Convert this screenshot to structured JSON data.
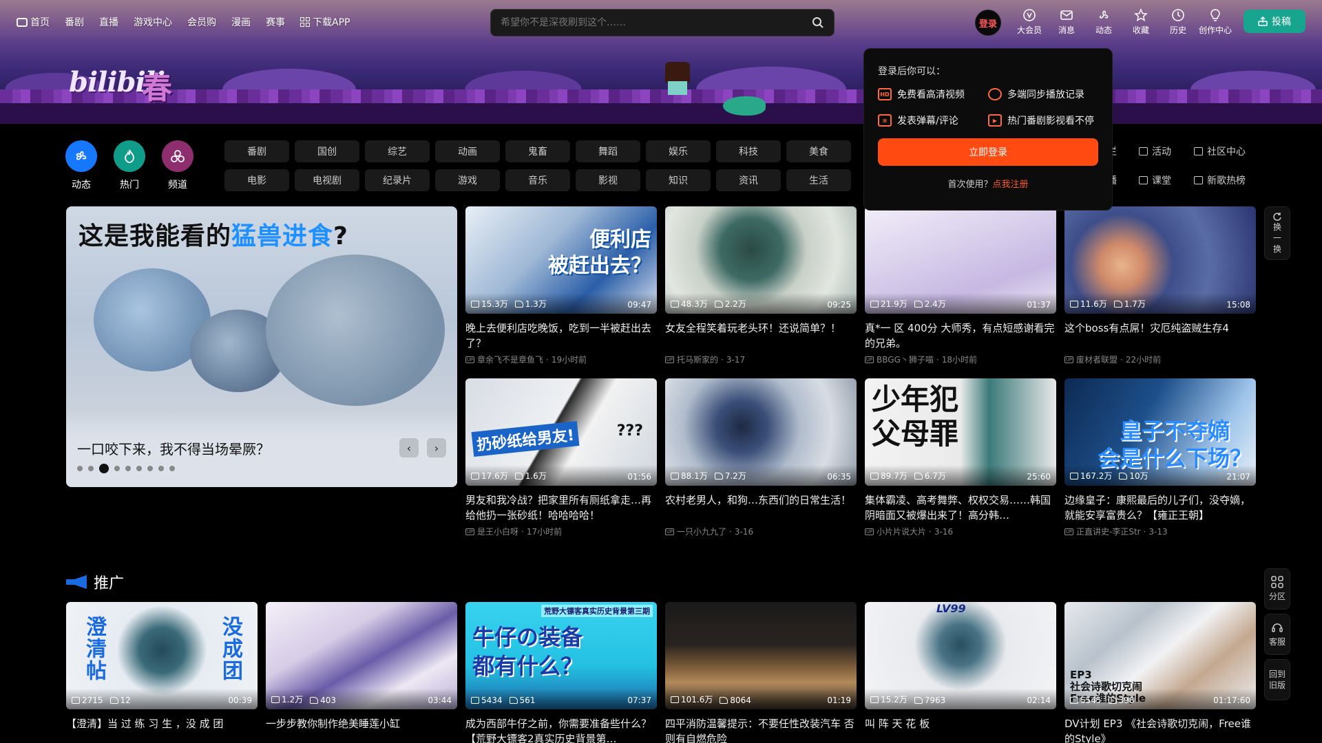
{
  "topnav": {
    "items": [
      "首页",
      "番剧",
      "直播",
      "游戏中心",
      "会员购",
      "漫画",
      "赛事",
      "下载APP"
    ]
  },
  "search": {
    "placeholder": "希望你不是深夜刷到这个……"
  },
  "header": {
    "login_avatar": "登录",
    "right": [
      "大会员",
      "消息",
      "动态",
      "收藏",
      "历史",
      "创作中心"
    ],
    "upload": "投稿"
  },
  "popover": {
    "head": "登录后你可以：",
    "perks": [
      "免费看高清视频",
      "多端同步播放记录",
      "发表弹幕/评论",
      "热门番剧影视看不停"
    ],
    "login_button": "立即登录",
    "register_prefix": "首次使用？",
    "register_link": "点我注册"
  },
  "quick": [
    "动态",
    "热门",
    "频道"
  ],
  "tags": [
    "番剧",
    "国创",
    "综艺",
    "动画",
    "鬼畜",
    "舞蹈",
    "娱乐",
    "科技",
    "美食",
    "电影",
    "电视剧",
    "纪录片",
    "游戏",
    "音乐",
    "影视",
    "知识",
    "资讯",
    "生活"
  ],
  "sidelinks": [
    "专栏",
    "活动",
    "社区中心",
    "直播",
    "课堂",
    "新歌热榜"
  ],
  "carousel": {
    "headline_pre": "这是我能看的",
    "headline_blue": "猛兽进食",
    "headline_post": "?",
    "title": "一口咬下来，我不得当场晕厥？",
    "dots": 9,
    "active_dot": 2
  },
  "feed": [
    {
      "views": "15.3万",
      "likes": "1.3万",
      "duration": "09:47",
      "title": "晚上去便利店吃晚饭，吃到一半被赶出去了？",
      "author": "章余飞不是章鱼飞",
      "time": "19小时前",
      "overlay": "便利店\n被赶出去？"
    },
    {
      "views": "48.3万",
      "likes": "2.2万",
      "duration": "09:25",
      "title": "女友全程笑着玩老头环！还说简单？！",
      "author": "托马斯家的",
      "time": "3-17",
      "overlay": ""
    },
    {
      "views": "21.9万",
      "likes": "2.4万",
      "duration": "01:37",
      "title": "真*一 区 400分 大师秀，有点短感谢看完的兄弟。",
      "author": "BBGG丶狮子喵",
      "time": "18小时前",
      "overlay": ""
    },
    {
      "views": "11.6万",
      "likes": "1.7万",
      "duration": "15:08",
      "title": "这个boss有点屌！灾厄纯盗贼生存4",
      "author": "废材者联盟",
      "time": "22小时前",
      "overlay": ""
    },
    {
      "views": "17.6万",
      "likes": "1.6万",
      "duration": "01:56",
      "title": "男友和我冷战？把家里所有厕纸拿走…再给他扔一张砂纸！哈哈哈哈！",
      "author": "是王小白呀",
      "time": "17小时前",
      "overlay": "扔砂纸给男友!"
    },
    {
      "views": "88.1万",
      "likes": "7.2万",
      "duration": "06:35",
      "title": "农村老男人，和狗…东西们的日常生活！",
      "author": "一只小九九了",
      "time": "3-16",
      "overlay": ""
    },
    {
      "views": "89.7万",
      "likes": "6.7万",
      "duration": "25:60",
      "title": "集体霸凌、高考舞弊、权权交易……韩国阴暗面又被爆出来了！高分韩…",
      "author": "小片片说大片",
      "time": "3-16",
      "overlay": "少年犯\n父母罪"
    },
    {
      "views": "167.2万",
      "likes": "10万",
      "duration": "21:07",
      "title": "边缘皇子：康熙最后的儿子们，没夺嫡，就能安享富贵么？【雍正王朝】",
      "author": "正直讲史-李正Str",
      "time": "3-13",
      "overlay": "皇子不夺嫡\n会是什么下场？"
    }
  ],
  "promo_title": "推广",
  "promo": [
    {
      "views": "2715",
      "likes": "12",
      "duration": "00:39",
      "title": "【澄清】当 过 练 习 生 ，没 成 团",
      "overlay_l": "澄清帖",
      "overlay_r": "没成团"
    },
    {
      "views": "1.2万",
      "likes": "403",
      "duration": "03:44",
      "title": "一步步教你制作绝美睡莲小缸"
    },
    {
      "views": "5434",
      "likes": "561",
      "duration": "07:37",
      "title": "成为西部牛仔之前，你需要准备些什么？【荒野大镖客2真实历史背景第…",
      "overlay_top": "荒野大镖客真实历史背景第三期",
      "overlay": "牛仔の装备\n都有什么？"
    },
    {
      "views": "101.6万",
      "likes": "8064",
      "duration": "01:19",
      "title": "四平消防温馨提示：不要任性改装汽车 否则有自燃危险"
    },
    {
      "views": "15.2万",
      "likes": "7963",
      "duration": "02:14",
      "title": "叫 阵 天 花 板",
      "overlay_top": "LV99"
    },
    {
      "views": "5545",
      "likes": "398",
      "duration": "01:17:60",
      "title": "DV计划 EP3 《社会诗歌切克闹，Free谁的Style》",
      "overlay": "EP3\n社会诗歌切克闹\nFree谁的Style"
    }
  ],
  "float": {
    "refresh": [
      "换",
      "一",
      "换"
    ],
    "buttons": [
      "分区",
      "客服",
      "回到旧版"
    ]
  },
  "colors": {
    "accent": "#ff4a12",
    "upload": "#18a58f",
    "link": "#ff5a2a"
  }
}
